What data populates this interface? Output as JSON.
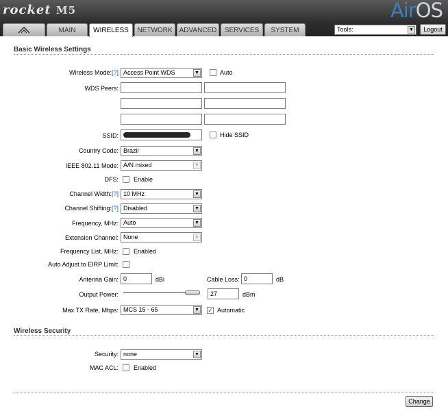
{
  "brand": {
    "product": "rocket",
    "model": "M5",
    "os_name_prefix": "Air",
    "os_name_suffix": "OS"
  },
  "tabs": {
    "logo_tab": "ubiquiti-logo",
    "main": "MAIN",
    "wireless": "WIRELESS",
    "network": "NETWORK",
    "advanced": "ADVANCED",
    "services": "SERVICES",
    "system": "SYSTEM",
    "active": "WIRELESS"
  },
  "tools": {
    "label": "Tools:",
    "logout": "Logout"
  },
  "basic": {
    "title": "Basic Wireless Settings",
    "wireless_mode": {
      "label": "Wireless Mode:",
      "help": "[?]",
      "value": "Access Point WDS",
      "auto_label": "Auto",
      "auto_checked": false
    },
    "wds_peers": {
      "label": "WDS Peers:",
      "values": [
        "",
        "",
        "",
        "",
        "",
        ""
      ]
    },
    "ssid": {
      "label": "SSID:",
      "value": "",
      "hide_label": "Hide SSID",
      "hide_checked": false
    },
    "country": {
      "label": "Country Code:",
      "value": "Brazil"
    },
    "ieee_mode": {
      "label": "IEEE 802.11 Mode:",
      "value": "A/N mixed"
    },
    "dfs": {
      "label": "DFS:",
      "option": "Enable",
      "checked": false
    },
    "channel_width": {
      "label": "Channel Width:",
      "help": "[?]",
      "value": "10 MHz"
    },
    "channel_shifting": {
      "label": "Channel Shifting:",
      "help": "[?]",
      "value": "Disabled"
    },
    "frequency": {
      "label": "Frequency, MHz:",
      "value": "Auto"
    },
    "extension_channel": {
      "label": "Extension Channel:",
      "value": "None"
    },
    "frequency_list": {
      "label": "Frequency List, MHz:",
      "option": "Enabled",
      "checked": false
    },
    "auto_eirp": {
      "label": "Auto Adjust to EIRP Limit:",
      "checked": false
    },
    "antenna_gain": {
      "label": "Antenna Gain:",
      "value": "0",
      "unit": "dBi"
    },
    "cable_loss": {
      "label": "Cable Loss:",
      "value": "0",
      "unit": "dB"
    },
    "output_power": {
      "label": "Output Power:",
      "value": "27",
      "unit": "dBm",
      "slider_level_pct": 92
    },
    "max_tx_rate": {
      "label": "Max TX Rate, Mbps:",
      "value": "MCS 15 - 65",
      "automatic_label": "Automatic",
      "automatic_checked": true
    }
  },
  "security": {
    "title": "Wireless Security",
    "security": {
      "label": "Security:",
      "value": "none"
    },
    "mac_acl": {
      "label": "MAC ACL:",
      "option": "Enabled",
      "checked": false
    }
  },
  "footer": {
    "change": "Change"
  },
  "colors": {
    "header": "#2f2f2f",
    "help_link": "#1a5db0",
    "os_accent": "#3a7fc0"
  }
}
